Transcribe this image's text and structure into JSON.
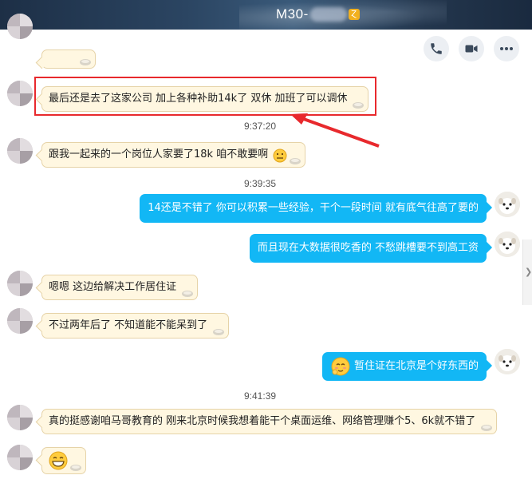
{
  "window": {
    "title": "M30-",
    "vip_badge": "Ɀ"
  },
  "toolbar": {
    "call": "phone-icon",
    "video": "video-icon",
    "more": "more-icon"
  },
  "timestamps": [
    "9:37:20",
    "9:39:35",
    "9:41:39"
  ],
  "messages": [
    {
      "side": "in",
      "text": "最后还是去了这家公司 加上各种补助14k了 双休 加班了可以调休"
    },
    {
      "side": "in",
      "text": "跟我一起来的一个岗位人家要了18k 咱不敢要啊"
    },
    {
      "side": "out",
      "text": "14还是不错了 你可以积累一些经验，干个一段时间 就有底气往高了要的"
    },
    {
      "side": "out",
      "text": "而且现在大数据很吃香的 不愁跳槽要不到高工资"
    },
    {
      "side": "in",
      "text": "嗯嗯 这边给解决工作居住证"
    },
    {
      "side": "in",
      "text": "不过两年后了 不知道能不能呆到了"
    },
    {
      "side": "out",
      "text": "暂住证在北京是个好东西的"
    },
    {
      "side": "in",
      "text": "真的挺感谢咱马哥教育的 刚来北京时候我想着能干个桌面运维、网络管理赚个5、6k就不错了"
    }
  ],
  "colors": {
    "incoming_bg": "#fff7e1",
    "outgoing_bg": "#12b7f5",
    "highlight": "#e8292d"
  }
}
